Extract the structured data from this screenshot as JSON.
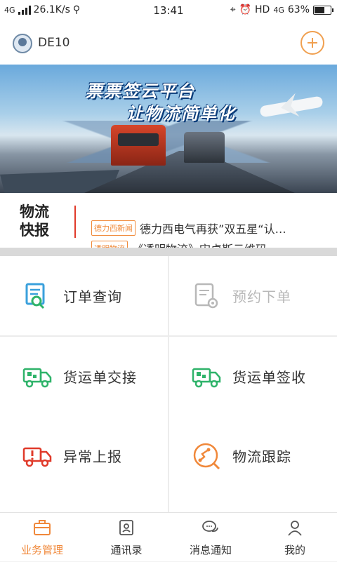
{
  "status_bar": {
    "network": "4G",
    "speed": "26.1K/s",
    "time": "13:41",
    "hd": "HD",
    "network2": "4G",
    "battery": "63%",
    "battery_level": 0.63
  },
  "header": {
    "title": "DE10"
  },
  "banner": {
    "line1": "票票签云平台",
    "line2": "让物流简单化"
  },
  "news": {
    "label_line1": "物流",
    "label_line2": "快报",
    "items": [
      {
        "tag": "德力西新闻",
        "text": "德力西电气再获”双五星“认…"
      },
      {
        "tag": "透明物流",
        "text": "《透明物流》宋卓斯云维码"
      }
    ]
  },
  "grid": {
    "items": [
      {
        "label": "订单查询",
        "icon": "order-search-icon",
        "enabled": true
      },
      {
        "label": "预约下单",
        "icon": "reserve-order-icon",
        "enabled": false
      },
      {
        "label": "货运单交接",
        "icon": "truck-handover-icon",
        "enabled": true
      },
      {
        "label": "货运单签收",
        "icon": "truck-signoff-icon",
        "enabled": true
      },
      {
        "label": "异常上报",
        "icon": "exception-report-icon",
        "enabled": true
      },
      {
        "label": "物流跟踪",
        "icon": "tracking-icon",
        "enabled": true
      }
    ]
  },
  "tabbar": {
    "tabs": [
      {
        "label": "业务管理",
        "icon": "briefcase-icon",
        "active": true
      },
      {
        "label": "通讯录",
        "icon": "contacts-icon",
        "active": false
      },
      {
        "label": "消息通知",
        "icon": "chat-icon",
        "active": false
      },
      {
        "label": "我的",
        "icon": "person-icon",
        "active": false
      }
    ]
  },
  "colors": {
    "accent": "#f0883a",
    "green": "#2fb36a",
    "blue": "#3aa0dc",
    "red": "#e03a2a"
  }
}
